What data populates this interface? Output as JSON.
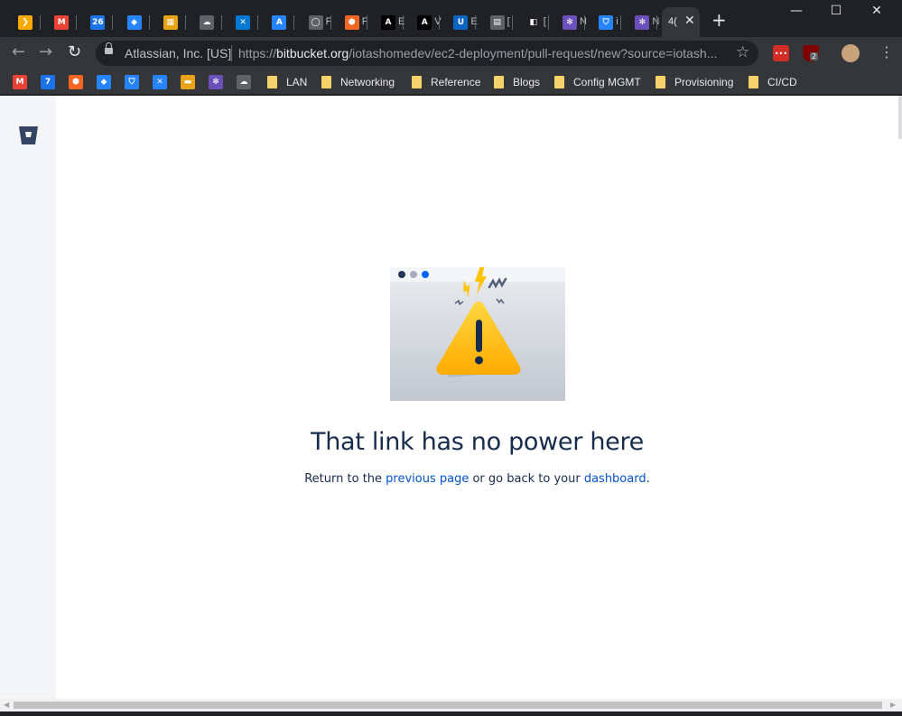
{
  "browser": {
    "tabs": [
      {
        "label": "",
        "color": "#f9ab00",
        "glyph": "❯"
      },
      {
        "label": "",
        "color": "#ea4335",
        "glyph": "M"
      },
      {
        "label": "",
        "color": "#1a73e8",
        "glyph": "26"
      },
      {
        "label": "",
        "color": "#2684ff",
        "glyph": "◆"
      },
      {
        "label": "",
        "color": "#e8a317",
        "glyph": "▦"
      },
      {
        "label": "",
        "color": "#5f6368",
        "glyph": "☁"
      },
      {
        "label": "",
        "color": "#0078d4",
        "glyph": "✕"
      },
      {
        "label": "",
        "color": "#2684ff",
        "glyph": "A"
      },
      {
        "label": "F",
        "color": "#5f6368",
        "glyph": "◯"
      },
      {
        "label": "F",
        "color": "#f26522",
        "glyph": "⬢"
      },
      {
        "label": "E",
        "color": "#000000",
        "glyph": "A"
      },
      {
        "label": "V",
        "color": "#000000",
        "glyph": "A"
      },
      {
        "label": "E",
        "color": "#0a66c2",
        "glyph": "U"
      },
      {
        "label": "[",
        "color": "#5f6368",
        "glyph": "▤"
      },
      {
        "label": "[",
        "color": "#202124",
        "glyph": "◧"
      },
      {
        "label": "N",
        "color": "#6b4fbb",
        "glyph": "✻"
      },
      {
        "label": "i",
        "color": "#2684ff",
        "glyph": "⛉"
      },
      {
        "label": "N",
        "color": "#6b4fbb",
        "glyph": "✻"
      }
    ],
    "active_tab": {
      "label": "4(",
      "close": "✕"
    },
    "new_tab": "+",
    "window_controls": {
      "minimize": "—",
      "maximize": "☐",
      "close": "✕"
    },
    "nav": {
      "back": "←",
      "forward": "→",
      "reload": "↻"
    },
    "omnibox": {
      "org": "Atlassian, Inc. [US]",
      "url_prefix": "https://",
      "url_domain": "bitbucket.org",
      "url_path": "/iotashomedev/ec2-deployment/pull-request/new?source=iotash...",
      "star": "☆"
    },
    "extensions": [
      {
        "name": "lastpass-icon",
        "color": "#d32d27",
        "badge": "•••"
      },
      {
        "name": "ublock-icon",
        "color": "#800000",
        "badge": "2"
      },
      {
        "name": "profile-avatar",
        "color": "#c8a27a",
        "badge": ""
      }
    ],
    "bookmarks": {
      "icons": [
        {
          "color": "#ea4335",
          "glyph": "M"
        },
        {
          "color": "#1a73e8",
          "glyph": "7"
        },
        {
          "color": "#f26522",
          "glyph": "⬢"
        },
        {
          "color": "#2684ff",
          "glyph": "◆"
        },
        {
          "color": "#2684ff",
          "glyph": "⛉"
        },
        {
          "color": "#2684ff",
          "glyph": "✕"
        },
        {
          "color": "#e8a317",
          "glyph": "▬"
        },
        {
          "color": "#6b4fbb",
          "glyph": "✻"
        },
        {
          "color": "#5f6368",
          "glyph": "☁"
        }
      ],
      "folders": [
        "LAN",
        "Networking",
        "Reference",
        "Blogs",
        "Config MGMT",
        "Provisioning",
        "CI/CD"
      ]
    }
  },
  "page": {
    "title": "That link has no power here",
    "body_before": "Return to the ",
    "link_previous": "previous page",
    "body_middle": " or go back to your ",
    "link_dashboard": "dashboard",
    "body_after": ".",
    "accent_link_color": "#0052cc",
    "title_color": "#172b4d"
  }
}
